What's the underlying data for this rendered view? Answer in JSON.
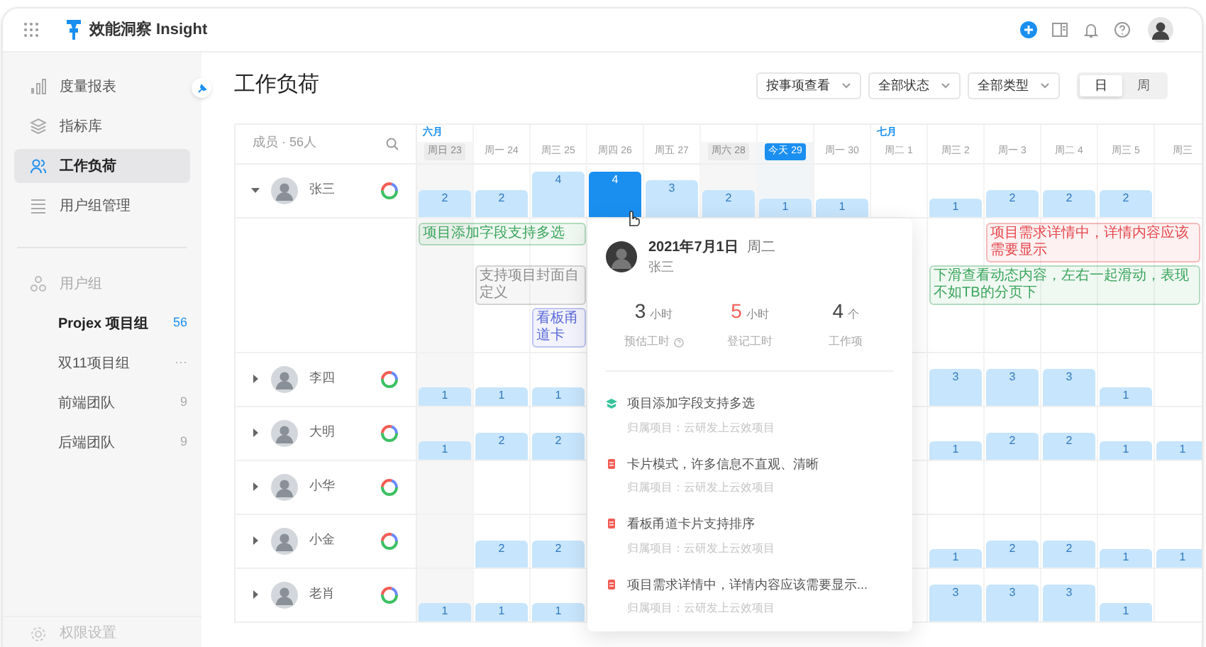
{
  "header": {
    "app_name": "效能洞察 Insight"
  },
  "sidebar": {
    "items": [
      {
        "label": "度量报表",
        "selected": false
      },
      {
        "label": "指标库",
        "selected": false
      },
      {
        "label": "工作负荷",
        "selected": true
      },
      {
        "label": "用户组管理",
        "selected": false
      }
    ],
    "groups_title": "用户组",
    "groups": [
      {
        "label": "Projex 项目组",
        "badge": "56",
        "selected": true
      },
      {
        "label": "双11项目组",
        "badge": "···",
        "selected": false
      },
      {
        "label": "前端团队",
        "badge": "9",
        "selected": false
      },
      {
        "label": "后端团队",
        "badge": "9",
        "selected": false
      }
    ],
    "footer": "权限设置"
  },
  "page_title": "工作负荷",
  "filters": [
    {
      "label": "按事项查看"
    },
    {
      "label": "全部状态"
    },
    {
      "label": "全部类型"
    }
  ],
  "view_toggle": [
    {
      "label": "日",
      "selected": true
    },
    {
      "label": "周",
      "selected": false
    }
  ],
  "members_header": "成员 · 56人",
  "days": [
    {
      "label": "周日 23",
      "month": "六月",
      "weekend": true,
      "today": false
    },
    {
      "label": "周一 24",
      "weekend": false,
      "today": false
    },
    {
      "label": "周三 25",
      "weekend": false,
      "today": false
    },
    {
      "label": "周四 26",
      "weekend": false,
      "today": false
    },
    {
      "label": "周五 27",
      "weekend": false,
      "today": false
    },
    {
      "label": "周六 28",
      "weekend": true,
      "today": false
    },
    {
      "label": "今天 29",
      "weekend": false,
      "today": true
    },
    {
      "label": "周一 30",
      "weekend": false,
      "today": false
    },
    {
      "label": "周二 1",
      "month": "七月",
      "weekend": false,
      "today": false
    },
    {
      "label": "周三 2",
      "weekend": false,
      "today": false
    },
    {
      "label": "周一 3",
      "weekend": false,
      "today": false
    },
    {
      "label": "周二 4",
      "weekend": false,
      "today": false
    },
    {
      "label": "周三 5",
      "weekend": false,
      "today": false
    },
    {
      "label": "周三",
      "weekend": false,
      "today": false
    }
  ],
  "members": [
    {
      "name": "张三",
      "expanded": true,
      "loads": [
        {
          "kind": "bar",
          "value": "2",
          "selected": false
        },
        {
          "kind": "bar",
          "value": "2",
          "selected": false
        },
        {
          "kind": "bar",
          "value": "4",
          "selected": false
        },
        {
          "kind": "bar",
          "value": "4",
          "selected": true
        },
        {
          "kind": "bar",
          "value": "3",
          "selected": false
        },
        {
          "kind": "bar",
          "value": "2",
          "selected": false
        },
        {
          "kind": "bar",
          "value": "1",
          "selected": false
        },
        {
          "kind": "bar",
          "value": "1",
          "selected": false
        },
        {
          "kind": "empty"
        },
        {
          "kind": "bar",
          "value": "1",
          "selected": false
        },
        {
          "kind": "bar",
          "value": "2",
          "selected": false
        },
        {
          "kind": "bar",
          "value": "2",
          "selected": false
        },
        {
          "kind": "bar",
          "value": "2",
          "selected": false
        }
      ],
      "task_lanes": [
        [
          {
            "kind": "task",
            "text": "项目添加字段支持多选",
            "color": "#3aa55c"
          },
          {
            "kind": "free"
          },
          {
            "kind": "free"
          },
          {
            "kind": "free"
          },
          {
            "kind": "free"
          },
          {
            "kind": "free"
          },
          {
            "kind": "free"
          },
          {
            "kind": "free"
          },
          {
            "kind": "free"
          },
          {
            "kind": "free"
          },
          {
            "kind": "task",
            "text": "项目需求详情中，详情内容应该需要显示",
            "color": "#e5484d"
          }
        ],
        [
          {
            "kind": "free"
          },
          {
            "kind": "task",
            "text": "支持项目封面自定义",
            "color": "#8c8c8c"
          },
          {
            "kind": "free"
          },
          {
            "kind": "free"
          },
          {
            "kind": "free"
          },
          {
            "kind": "free"
          },
          {
            "kind": "free"
          },
          {
            "kind": "free"
          },
          {
            "kind": "free"
          },
          {
            "kind": "task",
            "text": "下滑查看动态内容，左右一起滑动，表现不如TB的分页下",
            "color": "#3aa55c"
          }
        ],
        [
          {
            "kind": "free"
          },
          {
            "kind": "free"
          },
          {
            "kind": "task",
            "text": "看板甬道卡",
            "color": "#5b6ad8"
          }
        ]
      ]
    },
    {
      "name": "李四",
      "expanded": false,
      "loads": [
        {
          "kind": "bar",
          "value": "1",
          "selected": false
        },
        {
          "kind": "bar",
          "value": "1",
          "selected": false
        },
        {
          "kind": "bar",
          "value": "1",
          "selected": false
        },
        {
          "kind": "empty"
        },
        {
          "kind": "empty"
        },
        {
          "kind": "empty"
        },
        {
          "kind": "empty"
        },
        {
          "kind": "empty"
        },
        {
          "kind": "empty"
        },
        {
          "kind": "bar",
          "value": "3",
          "selected": false
        },
        {
          "kind": "bar",
          "value": "3",
          "selected": false
        },
        {
          "kind": "bar",
          "value": "3",
          "selected": false
        },
        {
          "kind": "bar",
          "value": "1",
          "selected": false
        }
      ]
    },
    {
      "name": "大明",
      "expanded": false,
      "loads": [
        {
          "kind": "bar",
          "value": "1",
          "selected": false
        },
        {
          "kind": "bar",
          "value": "2",
          "selected": false
        },
        {
          "kind": "bar",
          "value": "2",
          "selected": false
        },
        {
          "kind": "empty"
        },
        {
          "kind": "empty"
        },
        {
          "kind": "empty"
        },
        {
          "kind": "empty"
        },
        {
          "kind": "empty"
        },
        {
          "kind": "empty"
        },
        {
          "kind": "bar",
          "value": "1",
          "selected": false
        },
        {
          "kind": "bar",
          "value": "2",
          "selected": false
        },
        {
          "kind": "bar",
          "value": "2",
          "selected": false
        },
        {
          "kind": "bar",
          "value": "1",
          "selected": false
        },
        {
          "kind": "bar",
          "value": "1",
          "selected": false
        }
      ]
    },
    {
      "name": "小华",
      "expanded": false
    },
    {
      "name": "小金",
      "expanded": false,
      "loads": [
        {
          "kind": "empty"
        },
        {
          "kind": "bar",
          "value": "2",
          "selected": false
        },
        {
          "kind": "bar",
          "value": "2",
          "selected": false
        },
        {
          "kind": "empty"
        },
        {
          "kind": "empty"
        },
        {
          "kind": "empty"
        },
        {
          "kind": "empty"
        },
        {
          "kind": "empty"
        },
        {
          "kind": "empty"
        },
        {
          "kind": "bar",
          "value": "1",
          "selected": false
        },
        {
          "kind": "bar",
          "value": "2",
          "selected": false
        },
        {
          "kind": "bar",
          "value": "2",
          "selected": false
        },
        {
          "kind": "bar",
          "value": "1",
          "selected": false
        },
        {
          "kind": "bar",
          "value": "1",
          "selected": false
        }
      ]
    },
    {
      "name": "老肖",
      "expanded": false,
      "loads": [
        {
          "kind": "bar",
          "value": "1",
          "selected": false
        },
        {
          "kind": "bar",
          "value": "1",
          "selected": false
        },
        {
          "kind": "bar",
          "value": "1",
          "selected": false
        },
        {
          "kind": "empty"
        },
        {
          "kind": "empty"
        },
        {
          "kind": "empty"
        },
        {
          "kind": "empty"
        },
        {
          "kind": "empty"
        },
        {
          "kind": "empty"
        },
        {
          "kind": "bar",
          "value": "3",
          "selected": false
        },
        {
          "kind": "bar",
          "value": "3",
          "selected": false
        },
        {
          "kind": "bar",
          "value": "3",
          "selected": false
        },
        {
          "kind": "bar",
          "value": "1",
          "selected": false
        }
      ]
    }
  ],
  "tooltip": {
    "date": "2021年7月1日",
    "weekday": "周二",
    "member": "张三",
    "stats": [
      {
        "value": "3",
        "unit": "小时",
        "label": "预估工时",
        "help": true,
        "highlight": false
      },
      {
        "value": "5",
        "unit": "小时",
        "label": "登记工时",
        "help": false,
        "highlight": true
      },
      {
        "value": "4",
        "unit": "个",
        "label": "工作项",
        "help": false,
        "highlight": false
      }
    ],
    "items": [
      {
        "kind": "story",
        "title": "项目添加字段支持多选",
        "project": "归属项目：云研发上云效项目"
      },
      {
        "kind": "bug",
        "title": "卡片模式，许多信息不直观、清晰",
        "project": "归属项目：云研发上云效项目"
      },
      {
        "kind": "bug",
        "title": "看板甬道卡片支持排序",
        "project": "归属项目：云研发上云效项目"
      },
      {
        "kind": "bug",
        "title": "项目需求详情中，详情内容应该需要显示...",
        "project": "归属项目：云研发上云效项目"
      }
    ]
  }
}
